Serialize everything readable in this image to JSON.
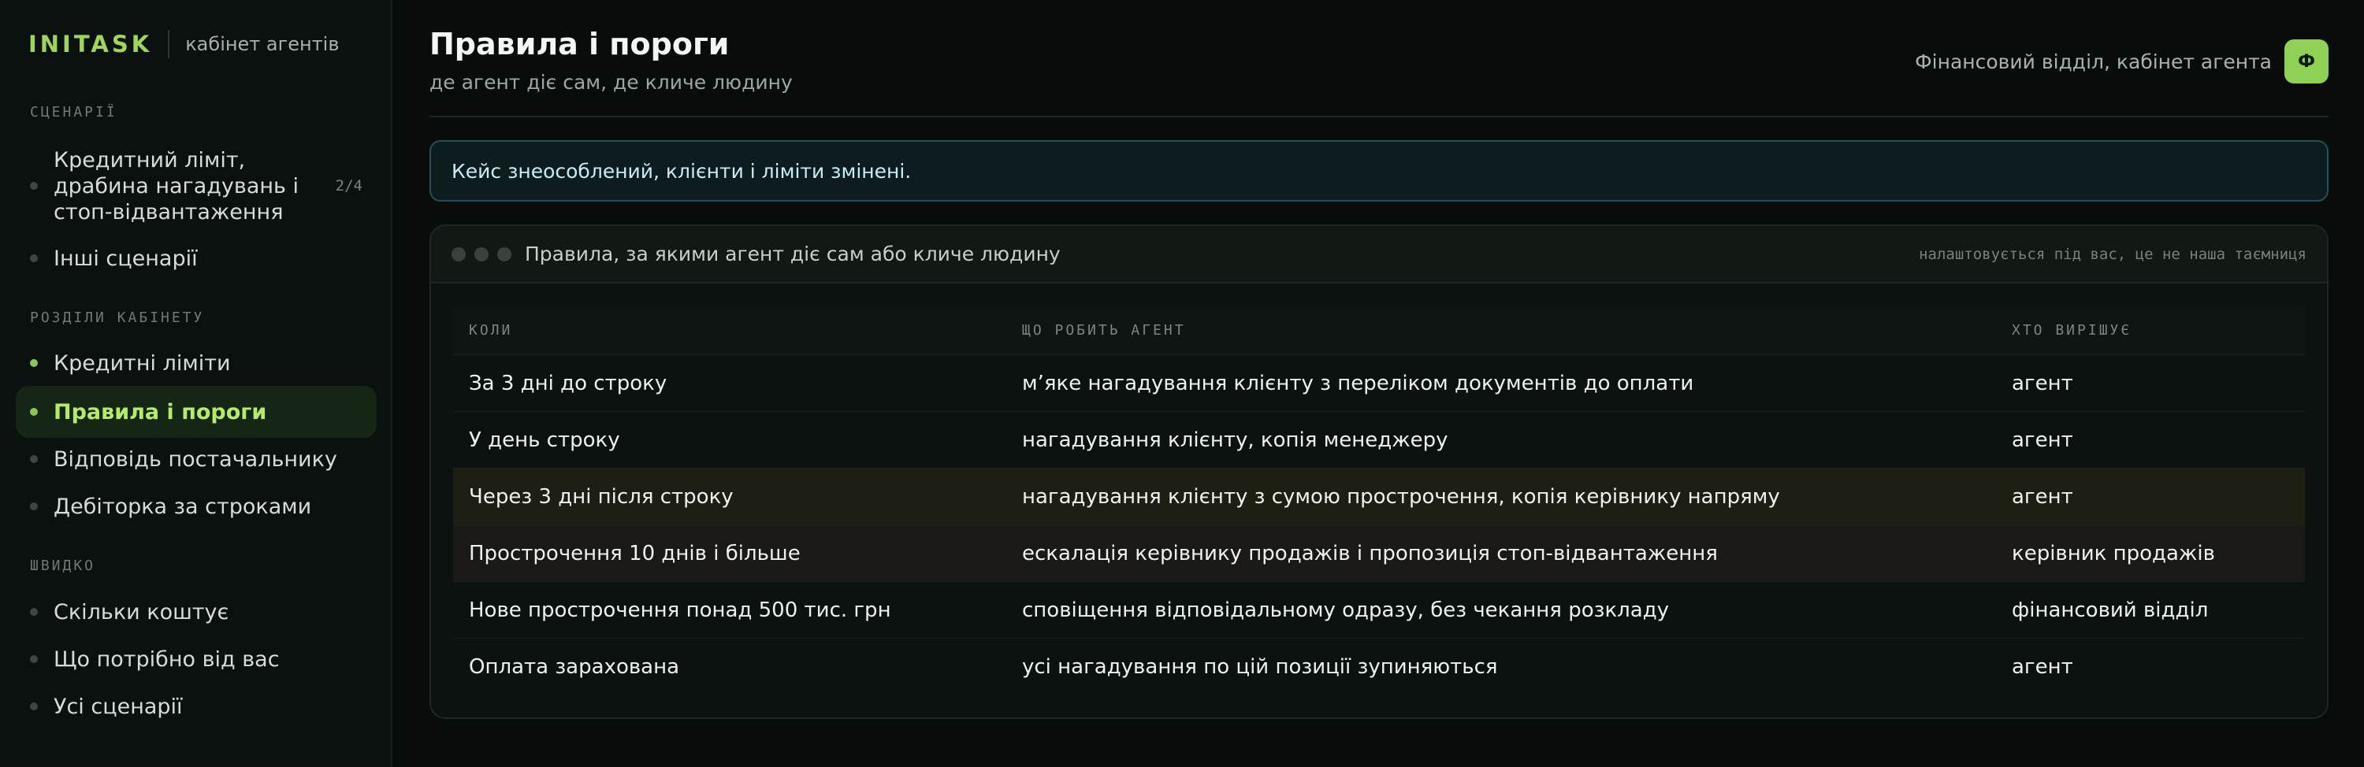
{
  "brand": {
    "name": "INITASK",
    "subtitle": "кабінет агентів"
  },
  "sidebar": {
    "scenarios_title": "СЦЕНАРІЇ",
    "scenarios": [
      {
        "label": "Кредитний ліміт, драбина нагадувань і стоп-відвантаження",
        "count": "2/4"
      },
      {
        "label": "Інші сценарії"
      }
    ],
    "sections_title": "РОЗДІЛИ КАБІНЕТУ",
    "sections": [
      {
        "label": "Кредитні ліміти"
      },
      {
        "label": "Правила і пороги",
        "active": true
      },
      {
        "label": "Відповідь постачальнику"
      },
      {
        "label": "Дебіторка за строками"
      }
    ],
    "quick_title": "ШВИДКО",
    "quick": [
      {
        "label": "Скільки коштує"
      },
      {
        "label": "Що потрібно від вас"
      },
      {
        "label": "Усі сценарії"
      }
    ]
  },
  "header": {
    "title": "Правила і пороги",
    "subtitle": "де агент діє сам, де кличе людину",
    "user": "Фінансовий відділ, кабінет агента",
    "avatar_letter": "Ф"
  },
  "notice": "Кейс знеособлений, клієнти і ліміти змінені.",
  "card": {
    "title": "Правила, за якими агент діє сам або кличе людину",
    "note": "налаштовується під вас, це не наша таємниця"
  },
  "table": {
    "columns": [
      "КОЛИ",
      "ЩО РОБИТЬ АГЕНТ",
      "ХТО ВИРІШУЄ"
    ],
    "rows": [
      [
        "За 3 дні до строку",
        "м’яке нагадування клієнту з переліком документів до оплати",
        "агент"
      ],
      [
        "У день строку",
        "нагадування клієнту, копія менеджеру",
        "агент"
      ],
      [
        "Через 3 дні після строку",
        "нагадування клієнту з сумою прострочення, копія керівнику напряму",
        "агент"
      ],
      [
        "Прострочення 10 днів і більше",
        "ескалація керівнику продажів і пропозиція стоп-відвантаження",
        "керівник продажів"
      ],
      [
        "Нове прострочення понад 500 тис. грн",
        "сповіщення відповідальному одразу, без чекання розкладу",
        "фінансовий відділ"
      ],
      [
        "Оплата зарахована",
        "усі нагадування по цій позиції зупиняються",
        "агент"
      ]
    ]
  },
  "colors": {
    "accent": "#9fd65a",
    "background": "#080d0b",
    "notice_border": "#25505a"
  }
}
